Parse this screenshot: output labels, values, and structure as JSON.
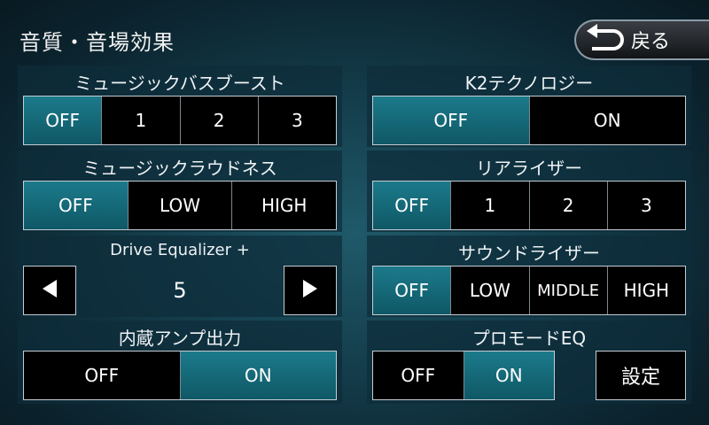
{
  "header": {
    "title": "音質・音場効果",
    "back_label": "戻る"
  },
  "left": {
    "bass_boost": {
      "title": "ミュージックバスブースト",
      "options": [
        "OFF",
        "1",
        "2",
        "3"
      ],
      "selected": "OFF"
    },
    "loudness": {
      "title": "ミュージックラウドネス",
      "options": [
        "OFF",
        "LOW",
        "HIGH"
      ],
      "selected": "OFF"
    },
    "drive_eq": {
      "title": "Drive Equalizer +",
      "value": "5"
    },
    "amp_output": {
      "title": "内蔵アンプ出力",
      "options": [
        "OFF",
        "ON"
      ],
      "selected": "ON"
    }
  },
  "right": {
    "k2": {
      "title": "K2テクノロジー",
      "options": [
        "OFF",
        "ON"
      ],
      "selected": "OFF"
    },
    "rear_riser": {
      "title": "リアライザー",
      "options": [
        "OFF",
        "1",
        "2",
        "3"
      ],
      "selected": "OFF"
    },
    "sound_riser": {
      "title": "サウンドライザー",
      "options": [
        "OFF",
        "LOW",
        "MIDDLE",
        "HIGH"
      ],
      "selected": "OFF"
    },
    "pro_mode_eq": {
      "title": "プロモードEQ",
      "options": [
        "OFF",
        "ON"
      ],
      "selected": "ON",
      "settings_label": "設定"
    }
  },
  "colors": {
    "selected": "#1b7a8a",
    "unselected": "#000000",
    "panel": "#0e2c3a"
  }
}
